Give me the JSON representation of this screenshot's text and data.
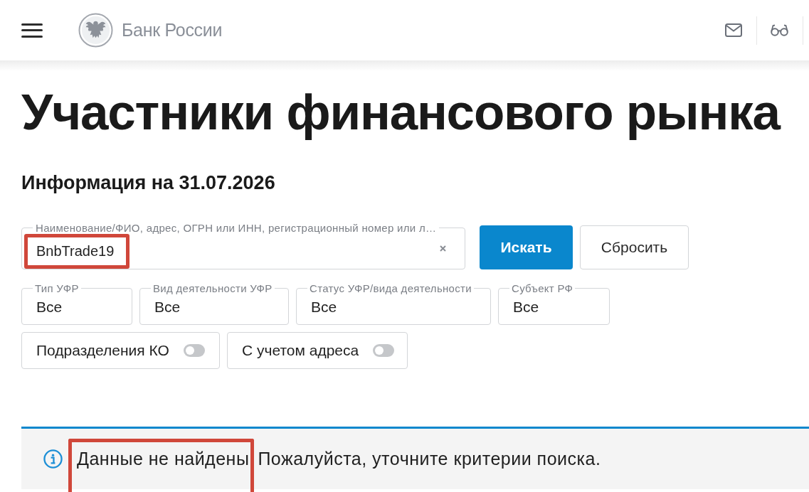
{
  "header": {
    "logo_text": "Банк России"
  },
  "title": "Участники финансового рынка",
  "info_date": "Информация на 31.07.2026",
  "search": {
    "label": "Наименование/ФИО, адрес, ОГРН или ИНН, регистрационный номер или л…",
    "value": "BnbTrade19",
    "highlighted": true
  },
  "buttons": [
    {
      "label": "Искать",
      "kind": "primary"
    },
    {
      "label": "Сбросить",
      "kind": "secondary"
    }
  ],
  "filters": [
    {
      "label": "Тип УФР",
      "value": "Все"
    },
    {
      "label": "Вид деятельности УФР",
      "value": "Все"
    },
    {
      "label": "Статус УФР/вида деятельности",
      "value": "Все"
    },
    {
      "label": "Субъект РФ",
      "value": "Все"
    }
  ],
  "toggles": [
    {
      "label": "Подразделения КО",
      "on": false
    },
    {
      "label": "С учетом адреса",
      "on": false
    }
  ],
  "notice": {
    "parts": [
      {
        "text": "Данные не найдены",
        "highlighted": true
      },
      {
        "text": "Пожалуйста, уточните критерии поиска.",
        "highlighted": false
      }
    ]
  }
}
